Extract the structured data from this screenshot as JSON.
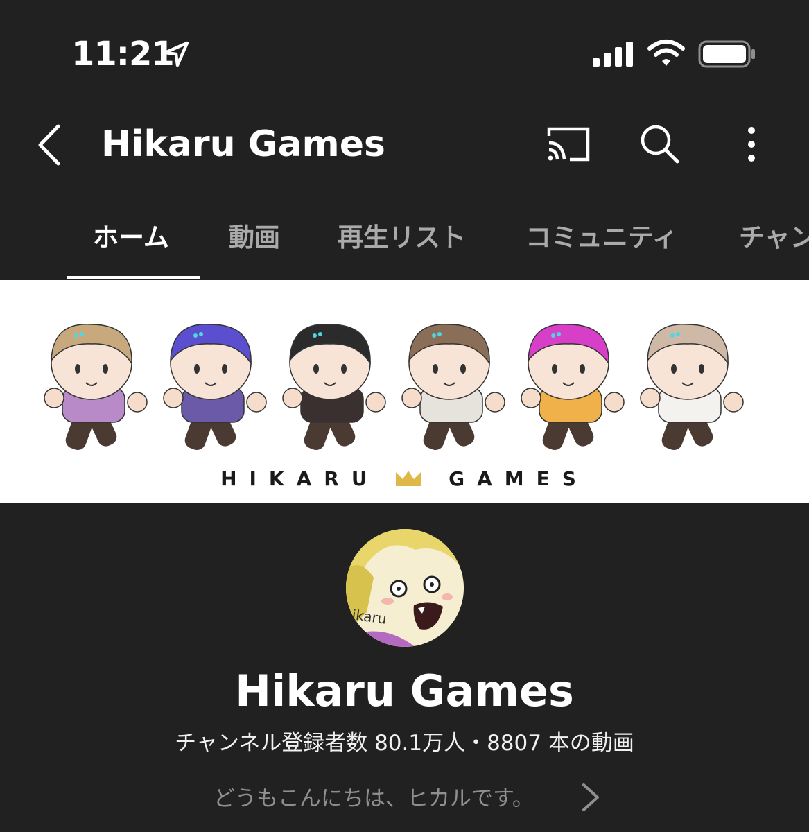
{
  "status_bar": {
    "time": "11:21",
    "icons": [
      "location-arrow-icon",
      "signal-icon",
      "wifi-icon",
      "battery-icon"
    ]
  },
  "app_bar": {
    "title": "Hikaru Games",
    "icons": [
      "back-icon",
      "cast-icon",
      "search-icon",
      "more-icon"
    ]
  },
  "tabs": [
    {
      "label": "ホーム",
      "active": true
    },
    {
      "label": "動画",
      "active": false
    },
    {
      "label": "再生リスト",
      "active": false
    },
    {
      "label": "コミュニティ",
      "active": false
    },
    {
      "label": "チャン",
      "active": false
    }
  ],
  "banner": {
    "text_left": "HIKARU",
    "text_right": "GAMES",
    "crown_color": "#e0b84a"
  },
  "channel": {
    "name": "Hikaru Games",
    "stats": "チャンネル登録者数 80.1万人・8807 本の動画",
    "description": "どうもこんにちは、ヒカルです。",
    "avatar_caption": "ikaru"
  },
  "colors": {
    "background": "#212121",
    "text": "#ffffff",
    "tab_inactive": "#aaaaaa",
    "description": "#8f8f8f"
  }
}
